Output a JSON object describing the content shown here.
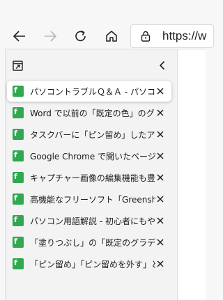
{
  "address_bar": {
    "url": "https://w"
  },
  "tabs": [
    {
      "title": "パソコントラブルＱ＆Ａ - パソコントラブル",
      "active": true,
      "favicon": "tab-favicon"
    },
    {
      "title": "Word で以前の「既定の色」のグラデーション",
      "active": false,
      "favicon": "tab-favicon"
    },
    {
      "title": "タスクバーに「ピン留め」したアプリをショー",
      "active": false,
      "favicon": "tab-favicon"
    },
    {
      "title": "Google Chrome で開いたページの URL",
      "active": false,
      "favicon": "tab-favicon"
    },
    {
      "title": "キャプチャー画像の編集機能も豊富な",
      "active": false,
      "favicon": "tab-favicon"
    },
    {
      "title": "高機能なフリーソフト「Greenshot」で",
      "active": false,
      "favicon": "tab-favicon"
    },
    {
      "title": "パソコン用語解説 - 初心者にもやさしい",
      "active": false,
      "favicon": "tab-favicon"
    },
    {
      "title": "「塗りつぶし」の「既定のグラデーション",
      "active": false,
      "favicon": "tab-favicon"
    },
    {
      "title": "「ピン留め」「ピン留めを外す」とは - パ",
      "active": false,
      "favicon": "tab-favicon"
    }
  ],
  "colors": {
    "favicon": "#2fa84f",
    "active_tab_bg": "#ffffff",
    "sidebar_bg": "#f3f3f3"
  }
}
